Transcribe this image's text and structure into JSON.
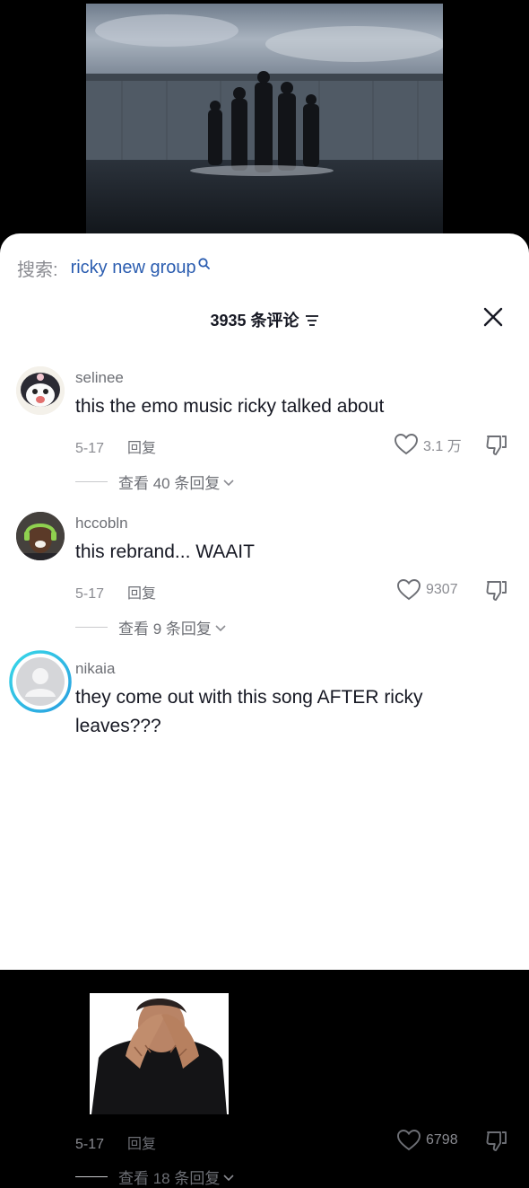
{
  "search": {
    "prefix": "搜索:",
    "query": "ricky new group"
  },
  "header": {
    "count_label": "3935 条评论"
  },
  "comments": [
    {
      "username": "selinee",
      "text": "this the emo music ricky talked about",
      "date": "5-17",
      "reply_label": "回复",
      "likes": "3.1 万",
      "view_replies": "查看 40 条回复"
    },
    {
      "username": "hccobln",
      "text": "this rebrand... WAAIT",
      "date": "5-17",
      "reply_label": "回复",
      "likes": "9307",
      "view_replies": "查看 9 条回复"
    },
    {
      "username": "nikaia",
      "text": "they come out with this song AFTER ricky leaves???",
      "date": "5-17",
      "reply_label": "回复",
      "likes": "6798",
      "view_replies": "查看 18 条回复"
    }
  ],
  "colors": {
    "link": "#2b5db0",
    "text": "#161823",
    "muted": "#8a8b91",
    "story_ring": "#2fc4e6"
  }
}
